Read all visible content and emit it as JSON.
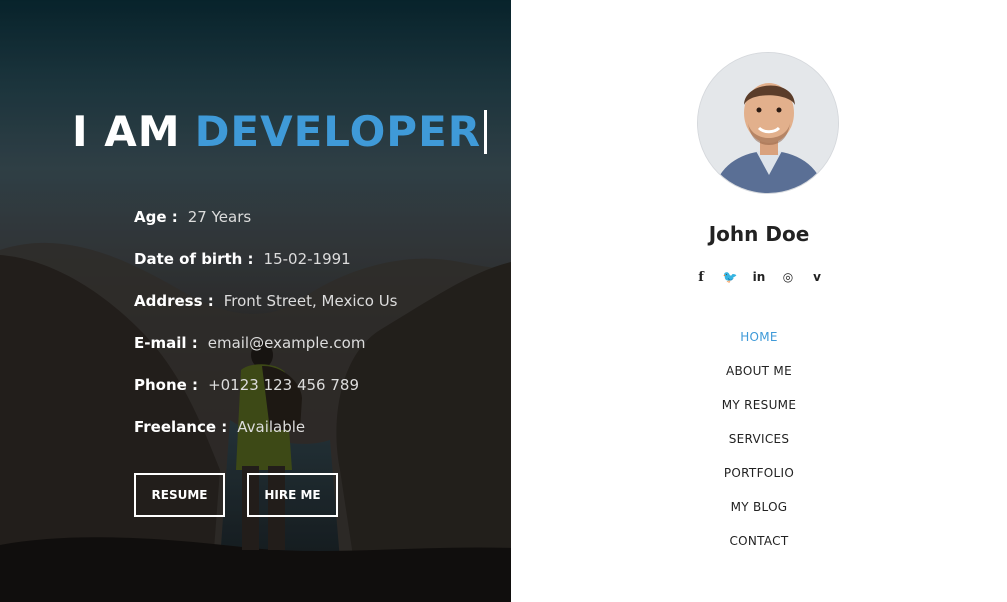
{
  "hero": {
    "headline_prefix": "I AM",
    "headline_role": "DEVELOPER",
    "info": [
      {
        "label": "Age :",
        "value": "27 Years"
      },
      {
        "label": "Date of birth :",
        "value": "15-02-1991"
      },
      {
        "label": "Address :",
        "value": "Front Street, Mexico Us"
      },
      {
        "label": "E-mail :",
        "value": "email@example.com"
      },
      {
        "label": "Phone :",
        "value": "+0123 123 456 789"
      },
      {
        "label": "Freelance :",
        "value": "Available"
      }
    ],
    "buttons": {
      "resume": "RESUME",
      "hire": "HIRE ME"
    }
  },
  "sidebar": {
    "name": "John Doe",
    "social": {
      "facebook": "f",
      "twitter": "🐦",
      "linkedin": "in",
      "instagram": "◎",
      "vimeo": "v"
    },
    "menu": [
      "HOME",
      "ABOUT ME",
      "MY RESUME",
      "SERVICES",
      "PORTFOLIO",
      "MY BLOG",
      "CONTACT"
    ],
    "active_menu": "HOME"
  },
  "colors": {
    "accent": "#3f9ad8",
    "text_dark": "#222222",
    "hero_text": "#ffffff"
  }
}
